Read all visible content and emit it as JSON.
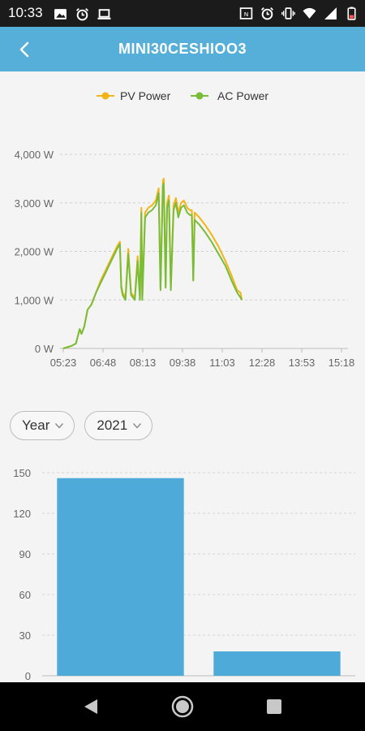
{
  "status_bar": {
    "time": "10:33",
    "left_icons": [
      "image-icon",
      "alarm-icon",
      "laptop-icon"
    ],
    "right_icons": [
      "nfc-icon",
      "alarm-icon",
      "vibrate-icon",
      "wifi-icon",
      "signal-icon",
      "battery-icon"
    ]
  },
  "header": {
    "title": "MINI30CESHIOO3",
    "back_icon": "chevron-left-icon"
  },
  "colors": {
    "header_bg": "#55afd8",
    "pv_power": "#f2b416",
    "ac_power": "#78bc38",
    "bar": "#4eaad8"
  },
  "power_chart": {
    "chart_data": {
      "type": "line",
      "y_ticks": [
        "4,000 W",
        "3,000 W",
        "2,000 W",
        "1,000 W",
        "0 W"
      ],
      "y_tick_values": [
        4000,
        3000,
        2000,
        1000,
        0
      ],
      "ylim": [
        0,
        4000
      ],
      "x_ticks": [
        "05:23",
        "06:48",
        "08:13",
        "09:38",
        "11:03",
        "12:28",
        "13:53",
        "15:18"
      ],
      "x_tick_minutes": [
        323,
        408,
        493,
        578,
        663,
        748,
        833,
        918
      ],
      "grid": true,
      "legend_position": "top-center",
      "series": [
        {
          "name": "PV Power",
          "color": "#f2b416",
          "points": [
            [
              323,
              0
            ],
            [
              340,
              50
            ],
            [
              350,
              100
            ],
            [
              358,
              400
            ],
            [
              362,
              300
            ],
            [
              368,
              450
            ],
            [
              375,
              800
            ],
            [
              383,
              900
            ],
            [
              393,
              1150
            ],
            [
              403,
              1400
            ],
            [
              413,
              1600
            ],
            [
              423,
              1800
            ],
            [
              433,
              2000
            ],
            [
              438,
              2100
            ],
            [
              444,
              2200
            ],
            [
              447,
              1300
            ],
            [
              450,
              1150
            ],
            [
              456,
              1050
            ],
            [
              462,
              2050
            ],
            [
              468,
              1150
            ],
            [
              476,
              1050
            ],
            [
              482,
              1900
            ],
            [
              487,
              1050
            ],
            [
              490,
              2900
            ],
            [
              492,
              1050
            ],
            [
              498,
              2800
            ],
            [
              505,
              2900
            ],
            [
              513,
              2950
            ],
            [
              521,
              3050
            ],
            [
              527,
              3300
            ],
            [
              531,
              1250
            ],
            [
              536,
              3450
            ],
            [
              538,
              3500
            ],
            [
              542,
              1300
            ],
            [
              545,
              3000
            ],
            [
              549,
              3150
            ],
            [
              553,
              1250
            ],
            [
              559,
              2950
            ],
            [
              564,
              3100
            ],
            [
              569,
              2800
            ],
            [
              575,
              3000
            ],
            [
              581,
              3050
            ],
            [
              588,
              2900
            ],
            [
              594,
              2850
            ],
            [
              598,
              2850
            ],
            [
              601,
              1400
            ],
            [
              604,
              2800
            ],
            [
              614,
              2700
            ],
            [
              626,
              2550
            ],
            [
              640,
              2350
            ],
            [
              655,
              2100
            ],
            [
              670,
              1800
            ],
            [
              683,
              1500
            ],
            [
              695,
              1200
            ],
            [
              702,
              1150
            ],
            [
              705,
              1000
            ]
          ]
        },
        {
          "name": "AC Power",
          "color": "#78bc38",
          "points": [
            [
              323,
              0
            ],
            [
              340,
              50
            ],
            [
              350,
              100
            ],
            [
              358,
              400
            ],
            [
              362,
              300
            ],
            [
              368,
              450
            ],
            [
              375,
              800
            ],
            [
              383,
              900
            ],
            [
              393,
              1150
            ],
            [
              403,
              1350
            ],
            [
              413,
              1550
            ],
            [
              423,
              1750
            ],
            [
              433,
              1950
            ],
            [
              438,
              2050
            ],
            [
              444,
              2150
            ],
            [
              447,
              1250
            ],
            [
              450,
              1100
            ],
            [
              456,
              1000
            ],
            [
              462,
              1950
            ],
            [
              468,
              1100
            ],
            [
              476,
              1000
            ],
            [
              482,
              1800
            ],
            [
              487,
              1000
            ],
            [
              490,
              2800
            ],
            [
              492,
              1000
            ],
            [
              498,
              2700
            ],
            [
              505,
              2800
            ],
            [
              513,
              2850
            ],
            [
              521,
              2950
            ],
            [
              527,
              3200
            ],
            [
              531,
              1200
            ],
            [
              536,
              3350
            ],
            [
              538,
              3400
            ],
            [
              542,
              1250
            ],
            [
              545,
              2900
            ],
            [
              549,
              3050
            ],
            [
              553,
              1200
            ],
            [
              559,
              2850
            ],
            [
              564,
              3000
            ],
            [
              569,
              2700
            ],
            [
              575,
              2900
            ],
            [
              581,
              2950
            ],
            [
              588,
              2800
            ],
            [
              594,
              2750
            ],
            [
              598,
              2750
            ],
            [
              601,
              1400
            ],
            [
              604,
              2650
            ],
            [
              614,
              2550
            ],
            [
              626,
              2400
            ],
            [
              640,
              2200
            ],
            [
              655,
              1950
            ],
            [
              670,
              1700
            ],
            [
              683,
              1400
            ],
            [
              695,
              1150
            ],
            [
              702,
              1050
            ],
            [
              705,
              1000
            ]
          ]
        }
      ]
    }
  },
  "selectors": {
    "period": "Year",
    "year": "2021",
    "chevron_icon": "chevron-down-icon"
  },
  "energy_chart": {
    "chart_data": {
      "type": "bar",
      "y_ticks": [
        "150",
        "120",
        "90",
        "60",
        "30",
        "0"
      ],
      "y_tick_values": [
        150,
        120,
        90,
        60,
        30,
        0
      ],
      "ylim": [
        0,
        150
      ],
      "grid": true,
      "values": [
        146,
        18
      ]
    }
  },
  "nav_bar": {
    "back_icon": "nav-back-triangle-icon",
    "home_icon": "nav-home-circle-icon",
    "recents_icon": "nav-recents-square-icon"
  }
}
